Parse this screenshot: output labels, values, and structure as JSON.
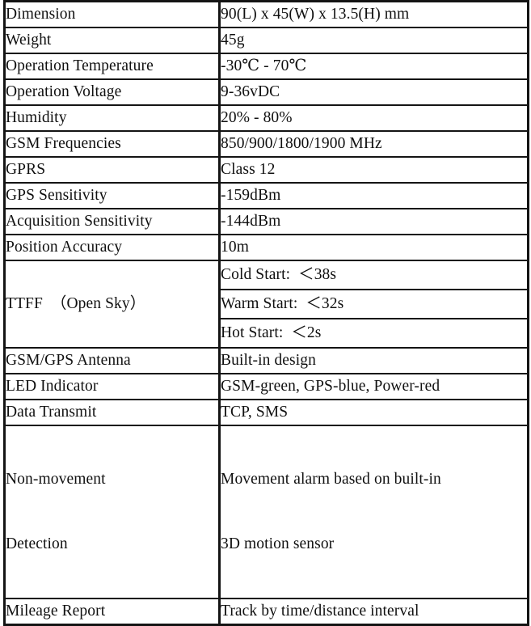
{
  "document": {
    "type": "specification-table",
    "column_count": 2,
    "text_color": "#101010",
    "border_color": "#141414",
    "background": "#ffffff"
  },
  "table": {
    "rows": [
      {
        "label": "Dimension",
        "value": "90(L) x 45(W) x 13.5(H) mm"
      },
      {
        "label": "Weight",
        "value": "45g"
      },
      {
        "label": "Operation Temperature",
        "value": "-30℃ - 70℃"
      },
      {
        "label": "Operation Voltage",
        "value": "9-36vDC"
      },
      {
        "label": "Humidity",
        "value": "20% - 80%"
      },
      {
        "label": "GSM Frequencies",
        "value": "850/900/1800/1900 MHz"
      },
      {
        "label": "GPRS",
        "value": "Class 12"
      },
      {
        "label": "GPS Sensitivity",
        "value": "-159dBm"
      },
      {
        "label": "Acquisition Sensitivity",
        "value": "-144dBm"
      },
      {
        "label": "Position Accuracy",
        "value": "10m"
      }
    ],
    "ttff": {
      "label": "TTFF  （Open Sky）",
      "entries": [
        "Cold Start:  ＜38s",
        "Warm Start:  ＜32s",
        "Hot Start:  ＜2s"
      ]
    },
    "rows_after": [
      {
        "label": "GSM/GPS Antenna",
        "value": "Built-in design"
      },
      {
        "label": "LED Indicator",
        "value": "GSM-green, GPS-blue, Power-red"
      },
      {
        "label": "Data Transmit",
        "value": "TCP, SMS"
      }
    ],
    "non_movement": {
      "label_line1": "Non-movement",
      "label_line2": "Detection",
      "value_line1": "Movement alarm based on built-in",
      "value_line2": "3D motion sensor"
    },
    "last_row": {
      "label": "Mileage Report",
      "value": "Track by time/distance interval"
    }
  }
}
